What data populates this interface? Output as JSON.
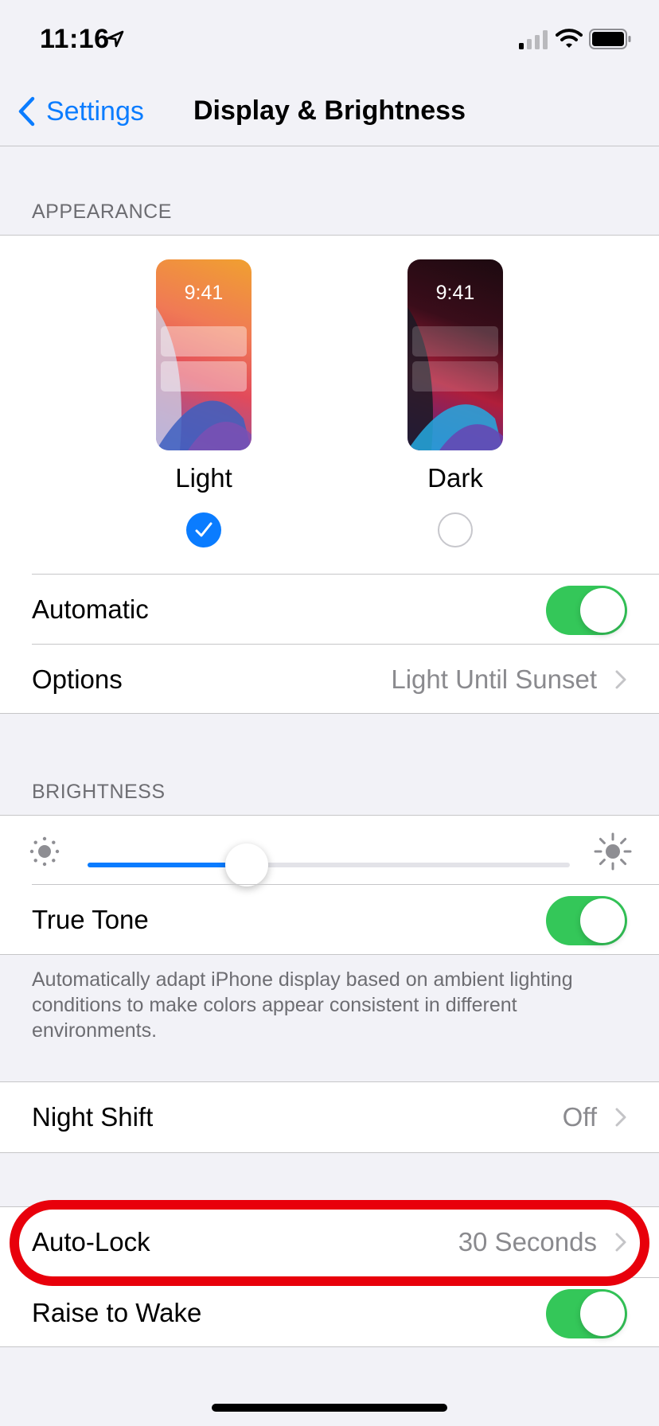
{
  "status_bar": {
    "time": "11:16",
    "icons": [
      "location-arrow-icon",
      "cellular-signal-icon",
      "wifi-icon",
      "battery-icon"
    ]
  },
  "nav": {
    "back_label": "Settings",
    "title": "Display & Brightness"
  },
  "appearance": {
    "header": "APPEARANCE",
    "options": [
      {
        "label": "Light",
        "preview_time": "9:41",
        "selected": true
      },
      {
        "label": "Dark",
        "preview_time": "9:41",
        "selected": false
      }
    ],
    "automatic": {
      "label": "Automatic",
      "on": true
    },
    "options_row": {
      "label": "Options",
      "value": "Light Until Sunset"
    }
  },
  "brightness": {
    "header": "BRIGHTNESS",
    "level": 0.33,
    "true_tone": {
      "label": "True Tone",
      "on": true
    },
    "footer": "Automatically adapt iPhone display based on ambient lighting conditions to make colors appear consistent in different environments."
  },
  "night_shift": {
    "label": "Night Shift",
    "value": "Off"
  },
  "auto_lock": {
    "label": "Auto-Lock",
    "value": "30 Seconds"
  },
  "raise_to_wake": {
    "label": "Raise to Wake",
    "on": true
  },
  "colors": {
    "accent": "#0a7cff",
    "toggle_on": "#34c759",
    "highlight": "#e8000b",
    "background": "#f2f2f7"
  }
}
